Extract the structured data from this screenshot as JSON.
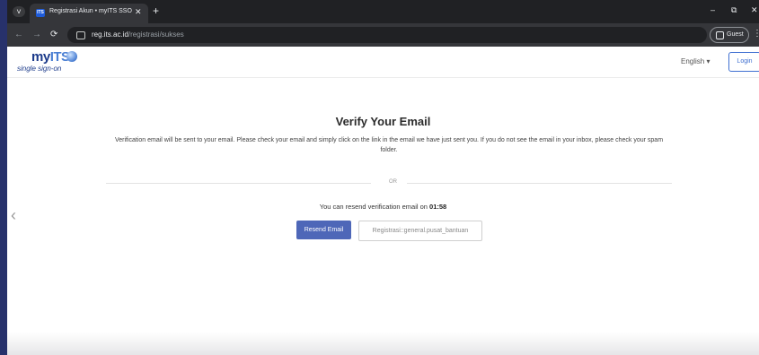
{
  "browser": {
    "tab_title": "Registrasi Akun • myITS SSO",
    "tab_favicon_text": "ITS",
    "url_domain": "reg.its.ac.id",
    "url_path": "/registrasi/sukses",
    "profile_label": "Guest",
    "controls": {
      "minimize": "–",
      "restore": "⧉",
      "close": "✕",
      "new_tab": "+",
      "tab_close": "✕",
      "tab_menu": "˅",
      "back": "←",
      "forward": "→",
      "reload": "⟳",
      "menu": "⋮"
    }
  },
  "header": {
    "logo_main": "my",
    "logo_accent": "ITS",
    "logo_sub": "single sign-on",
    "language": "English ▾",
    "login_label": "Login"
  },
  "main": {
    "title": "Verify Your Email",
    "description": "Verification email will be sent to your email. Please check your email and simply click on the link in the email we have just sent you. If you do not see the email in your inbox, please check your spam folder.",
    "or_label": "OR",
    "resend_prefix": "You can resend verification email on ",
    "countdown": "01:58",
    "resend_button": "Resend Email",
    "help_button": "Registrasi::general.pusat_bantuan"
  },
  "nav": {
    "left_arrow": "‹"
  },
  "colors": {
    "primary": "#4e67b8",
    "brand": "#1b3a8a",
    "outer_bg": "#27316b"
  }
}
